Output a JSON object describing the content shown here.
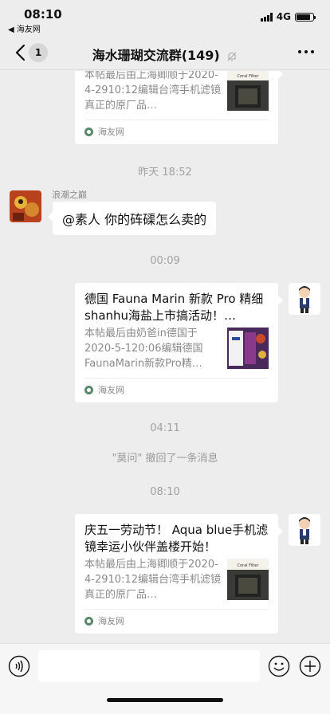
{
  "status_bar": {
    "time": "08:10",
    "back_app": "◀ 海友网",
    "network": "4G"
  },
  "nav": {
    "badge": "1",
    "title": "海水珊瑚交流群(149)"
  },
  "messages": {
    "card_top": {
      "desc": "本帖最后由上海卿顺于2020-4-2910:12编辑台湾手机滤镜真正的原厂品…",
      "source": "海友网",
      "thumb_label": "Coral Filter"
    },
    "time1": "昨天 18:52",
    "msg1": {
      "sender": "浪潮之巅",
      "text": "@素人 你的砗磲怎么卖的"
    },
    "time2": "00:09",
    "card2": {
      "title": "德国 Fauna Marin 新款 Pro 精细shanhu海盐上市搞活动！…",
      "desc": "本帖最后由奶爸in德国于2020-5-120:06编辑德国FaunaMarin新款Pro精…",
      "source": "海友网"
    },
    "time3": "04:11",
    "system1": "\"莫问\" 撤回了一条消息",
    "time4": "08:10",
    "card3": {
      "title": "庆五一劳动节！ Aqua blue手机滤镜幸运小伙伴盖楼开始！",
      "desc": "本帖最后由上海卿顺于2020-4-2910:12编辑台湾手机滤镜真正的原厂品…",
      "source": "海友网",
      "thumb_label": "Coral Filter"
    }
  }
}
